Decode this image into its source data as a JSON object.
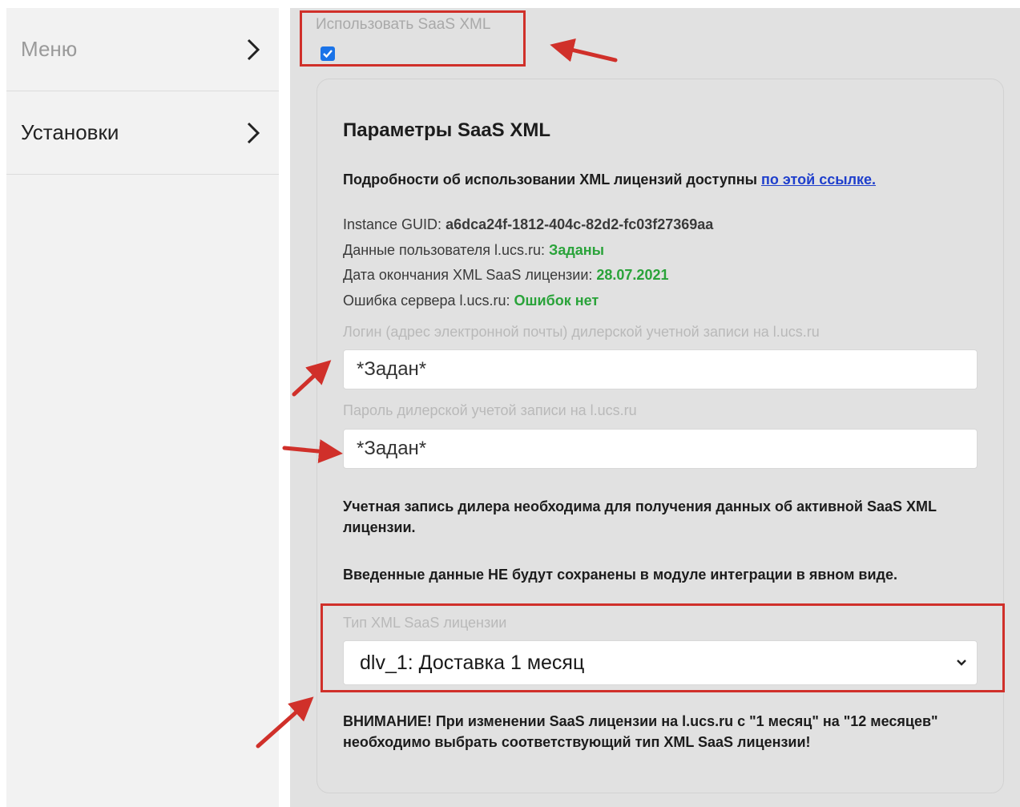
{
  "sidebar": {
    "items": [
      {
        "label": "Меню"
      },
      {
        "label": "Установки"
      }
    ]
  },
  "use_saas": {
    "label": "Использовать SaaS XML",
    "checked": true
  },
  "params": {
    "title": "Параметры SaaS XML",
    "details_text": "Подробности об использовании XML лицензий доступны ",
    "details_link": "по этой ссылке.",
    "guid_label": "Instance GUID: ",
    "guid_value": "a6dca24f-1812-404c-82d2-fc03f27369aa",
    "user_data_label": "Данные пользователя l.ucs.ru: ",
    "user_data_value": "Заданы",
    "expiry_label": "Дата окончания XML SaaS лицензии: ",
    "expiry_value": "28.07.2021",
    "server_error_label": "Ошибка сервера l.ucs.ru: ",
    "server_error_value": "Ошибок нет",
    "login_label": "Логин (адрес электронной почты) дилерской учетной записи на l.ucs.ru",
    "login_value": "*Задан*",
    "password_label": "Пароль дилерской учетой записи на l.ucs.ru",
    "password_value": "*Задан*",
    "dealer_note": "Учетная запись дилера необходима для получения данных об активной SaaS XML лицензии.",
    "not_saved_note": "Введенные данные НЕ будут сохранены в модуле интеграции в явном виде.",
    "license_type_label": "Тип XML SaaS лицензии",
    "license_type_value": "dlv_1: Доставка 1 месяц",
    "warning": "ВНИМАНИЕ! При изменении SaaS лицензии на l.ucs.ru с \"1 месяц\" на \"12 месяцев\" необходимо выбрать соответствующий тип XML SaaS лицензии!"
  },
  "colors": {
    "highlight": "#d0302a",
    "accent_green": "#2aa33a",
    "link": "#1f3fcc",
    "checkbox": "#1a73e8"
  }
}
